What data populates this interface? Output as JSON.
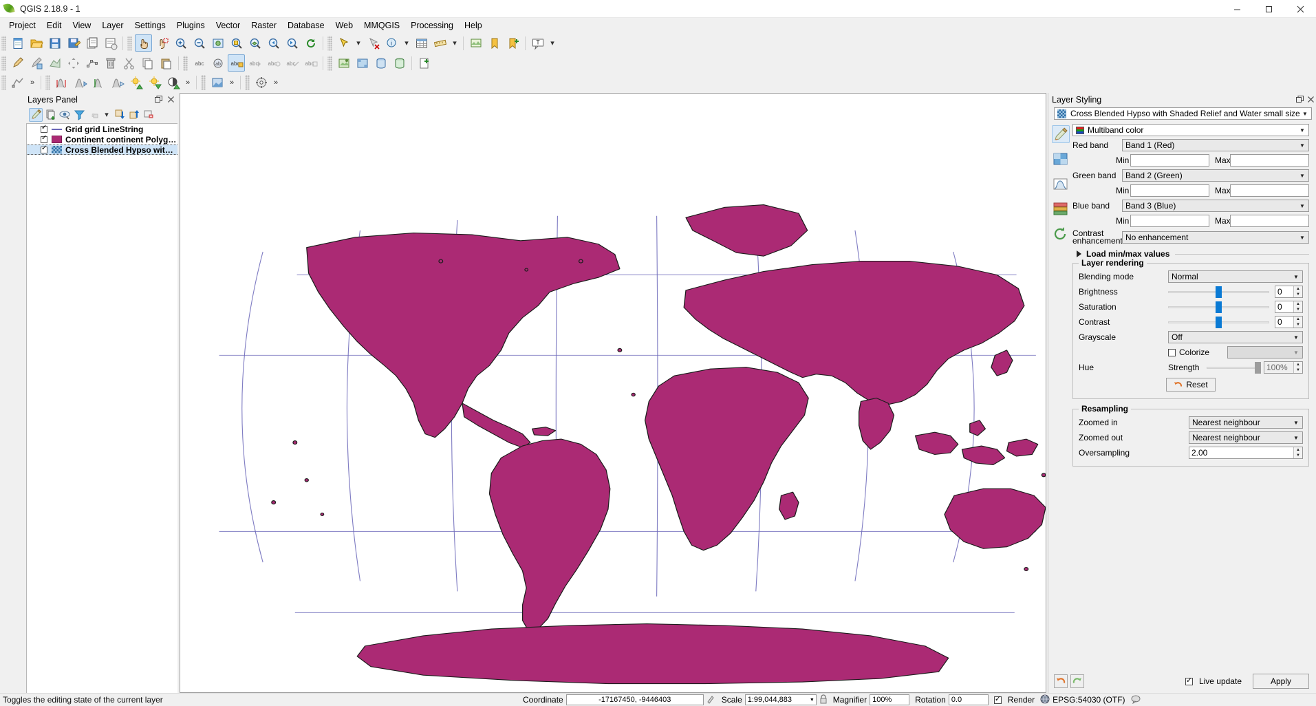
{
  "window": {
    "title": "QGIS 2.18.9 - 1",
    "app_icon": "qgis-leaf-icon",
    "minimize": "minimize-button",
    "maximize": "maximize-button",
    "close": "close-button"
  },
  "menubar": {
    "items": [
      {
        "label": "Project"
      },
      {
        "label": "Edit"
      },
      {
        "label": "View"
      },
      {
        "label": "Layer"
      },
      {
        "label": "Settings"
      },
      {
        "label": "Plugins"
      },
      {
        "label": "Vector"
      },
      {
        "label": "Raster"
      },
      {
        "label": "Database"
      },
      {
        "label": "Web"
      },
      {
        "label": "MMQGIS"
      },
      {
        "label": "Processing"
      },
      {
        "label": "Help"
      }
    ]
  },
  "layers_panel": {
    "title": "Layers Panel",
    "float_button": "float-panel-button",
    "close_button": "close-panel-button",
    "toolbar": [
      {
        "name": "open-layer-styling-panel",
        "active": true
      },
      {
        "name": "add-group",
        "active": false
      },
      {
        "name": "manage-layer-visibility",
        "active": false
      },
      {
        "name": "filter-legend-by-map-content",
        "active": false
      },
      {
        "name": "filter-legend-by-expression",
        "active": false
      },
      {
        "name": "expand-all",
        "active": false
      },
      {
        "name": "collapse-all",
        "active": false
      },
      {
        "name": "remove-layer-or-group",
        "active": false
      }
    ],
    "layers": [
      {
        "name": "Grid grid LineString",
        "checked": true,
        "symbol": "line",
        "selected": false
      },
      {
        "name": "Continent continent Polygon",
        "checked": true,
        "symbol": "poly",
        "selected": false
      },
      {
        "name": "Cross Blended Hypso with Shaded Relief ...",
        "checked": true,
        "symbol": "raster",
        "selected": true
      }
    ]
  },
  "style_panel": {
    "title": "Layer Styling",
    "float_button": "float-panel-button",
    "close_button": "close-panel-button",
    "layer_selector": "Cross Blended Hypso with Shaded Relief and Water small size",
    "layer_icon": "raster-layer-icon",
    "tabs": [
      {
        "name": "symbology-tab",
        "icon": "paintbrush-icon",
        "active": true
      },
      {
        "name": "transparency-tab",
        "icon": "transparency-icon",
        "active": false
      },
      {
        "name": "histogram-tab",
        "icon": "histogram-icon",
        "active": false
      },
      {
        "name": "rendering-tab",
        "icon": "rendering-icon",
        "active": false
      },
      {
        "name": "undo-history-tab",
        "icon": "history-icon",
        "active": false
      }
    ],
    "renderer": "Multiband color",
    "bands": [
      {
        "label": "Red band",
        "value": "Band 1 (Red)",
        "min_label": "Min",
        "min_value": "",
        "max_label": "Max",
        "max_value": ""
      },
      {
        "label": "Green band",
        "value": "Band 2 (Green)",
        "min_label": "Min",
        "min_value": "",
        "max_label": "Max",
        "max_value": ""
      },
      {
        "label": "Blue band",
        "value": "Band 3 (Blue)",
        "min_label": "Min",
        "min_value": "",
        "max_label": "Max",
        "max_value": ""
      }
    ],
    "contrast": {
      "label_line1": "Contrast",
      "label_line2": "enhancement",
      "value": "No enhancement"
    },
    "load_minmax": "Load min/max values",
    "layer_rendering": {
      "title": "Layer rendering",
      "blending_label": "Blending mode",
      "blending_value": "Normal",
      "brightness_label": "Brightness",
      "brightness_value": "0",
      "saturation_label": "Saturation",
      "saturation_value": "0",
      "contrast_label": "Contrast",
      "contrast_value": "0",
      "grayscale_label": "Grayscale",
      "grayscale_value": "Off",
      "hue_label": "Hue",
      "colorize_label": "Colorize",
      "colorize_checked": false,
      "strength_label": "Strength",
      "strength_value": "100%",
      "reset_label": "Reset"
    },
    "resampling": {
      "title": "Resampling",
      "zoomed_in_label": "Zoomed in",
      "zoomed_in_value": "Nearest neighbour",
      "zoomed_out_label": "Zoomed out",
      "zoomed_out_value": "Nearest neighbour",
      "oversampling_label": "Oversampling",
      "oversampling_value": "2.00"
    },
    "footer": {
      "undo": "undo-button",
      "redo": "redo-button",
      "live_update_label": "Live update",
      "live_update_checked": true,
      "apply_label": "Apply"
    }
  },
  "map": {
    "background": "#ffffff",
    "continent_fill": "#ab2a74",
    "continent_stroke": "#1d1d1d",
    "graticule_color": "#6a66b8"
  },
  "statusbar": {
    "message": "Toggles the editing state of the current layer",
    "coordinate_label": "Coordinate",
    "coordinate_value": "-17167450, -9446403",
    "scale_label": "Scale",
    "scale_value": "1:99,044,883",
    "magnifier_label": "Magnifier",
    "magnifier_value": "100%",
    "rotation_label": "Rotation",
    "rotation_value": "0.0",
    "render_label": "Render",
    "render_checked": true,
    "crs_value": "EPSG:54030 (OTF)"
  }
}
